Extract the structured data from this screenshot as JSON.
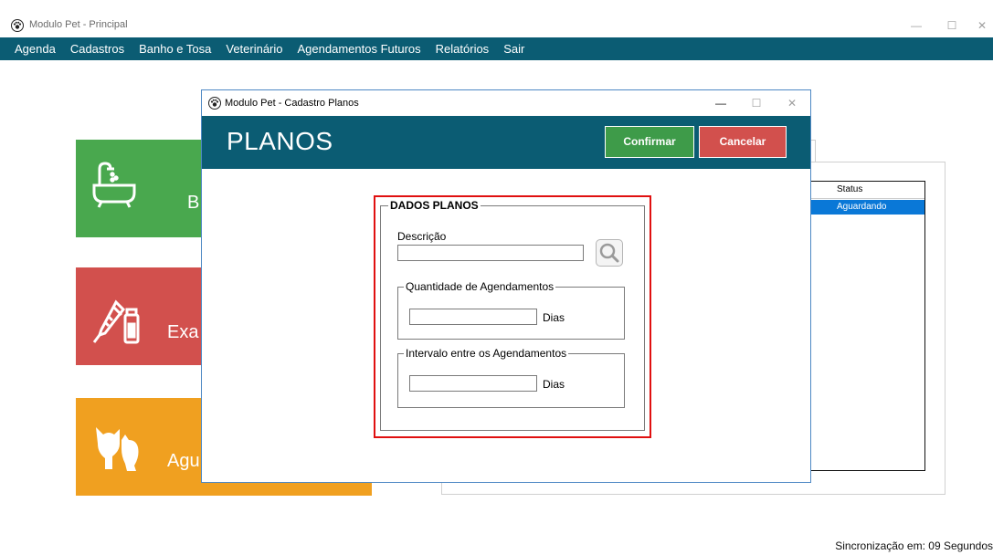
{
  "main_window": {
    "title": "Modulo Pet - Principal",
    "controls": {
      "minimize": "—",
      "maximize": "☐",
      "close": "✕"
    }
  },
  "menu": [
    {
      "label": "Agenda"
    },
    {
      "label": "Cadastros"
    },
    {
      "label": "Banho e Tosa"
    },
    {
      "label": "Veterinário"
    },
    {
      "label": "Agendamentos Futuros"
    },
    {
      "label": "Relatórios"
    },
    {
      "label": "Sair"
    }
  ],
  "tiles": [
    {
      "label": "B",
      "color": "#49a84e",
      "icon": "bathtub-icon"
    },
    {
      "label": "Exa",
      "color": "#d2504d",
      "icon": "syringe-vial-icon"
    },
    {
      "label": "Agu",
      "color": "#f0a020",
      "icon": "dog-cat-icon"
    }
  ],
  "background_list": {
    "column_header": "Status",
    "rows": [
      {
        "status": "Aguardando"
      }
    ]
  },
  "status_bar": {
    "sync_text": "Sincronização em: 09 Segundos"
  },
  "dialog": {
    "title": "Modulo Pet - Cadastro Planos",
    "header_title": "PLANOS",
    "controls": {
      "minimize": "—",
      "maximize": "☐",
      "close": "✕"
    },
    "buttons": {
      "confirm": "Confirmar",
      "cancel": "Cancelar"
    },
    "form": {
      "group_title": "DADOS PLANOS",
      "descricao_label": "Descrição",
      "descricao_value": "",
      "qtd_group_title": "Quantidade de Agendamentos",
      "qtd_value": "",
      "qtd_unit": "Dias",
      "intervalo_group_title": "Intervalo entre os Agendamentos",
      "intervalo_value": "",
      "intervalo_unit": "Dias"
    }
  },
  "colors": {
    "brand_teal": "#0b5c73",
    "confirm_green": "#3e9b49",
    "cancel_red": "#d2504d",
    "highlight_red": "#e01010",
    "selection_blue": "#0a78d7"
  }
}
